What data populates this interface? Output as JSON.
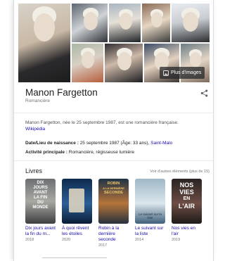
{
  "knowledge_panel": {
    "more_images_label": "Plus d'images",
    "title": "Manon Fargetton",
    "subtitle": "Romancière",
    "description": "Manon Fargetton, née le 25 septembre 1987, est une romancière française.",
    "wiki_link": "Wikipédia",
    "facts": [
      {
        "label": "Date/Lieu de naissance :",
        "value": "25 septembre 1987 (Âge: 33 ans),",
        "link": "Saint-Malo"
      },
      {
        "label": "Activité principale :",
        "value": "Romancière, régisseuse lumière",
        "link": ""
      }
    ],
    "books_section": {
      "title": "Livres",
      "more_link": "Voir d'autres éléments (plus de 15)",
      "books": [
        {
          "title": "Dix jours avant la fin du m...",
          "year": "2018",
          "cover_text": [
            "DIX",
            "JOURS",
            "AVANT",
            "LA FIN",
            "DU",
            "MONDE"
          ]
        },
        {
          "title": "À quoi rêvent les étoiles",
          "year": "2020",
          "cover_text": []
        },
        {
          "title": "Robin à la dernière seconde",
          "year": "2017",
          "cover_text": [
            "ROBIN",
            "A LA DERNIÈRE",
            "SECONDE"
          ]
        },
        {
          "title": "Le suivant sur la liste",
          "year": "2014",
          "cover_text": [
            "Le suivant sur la liste"
          ]
        },
        {
          "title": "Nos vies en l'air",
          "year": "2019",
          "cover_text": [
            "NOS",
            "VIES",
            "EN",
            "L'AIR"
          ]
        }
      ]
    }
  },
  "icons": {
    "share": "share-icon",
    "images": "image-icon"
  }
}
